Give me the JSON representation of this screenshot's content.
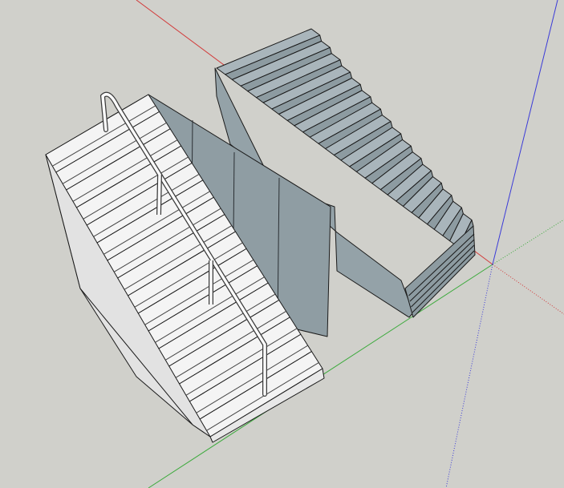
{
  "viewport": {
    "background": "#d0d0cb",
    "axis_colors": {
      "red": "#d23a3a",
      "green": "#3caa3c",
      "blue": "#3a3ad8"
    }
  },
  "models": {
    "white_stair": {
      "tread_color": "#f4f4f4",
      "side_color": "#e2e2e2",
      "edge_color": "#1a1a1a",
      "step_count": 16,
      "handrail_post_count": 4
    },
    "gray_stair": {
      "tread_color": "#a9b5bb",
      "riser_color": "#8d9ba1",
      "side_color": "#94a2a8",
      "edge_color": "#1a1a1a",
      "step_count": 16
    },
    "partition_wall": {
      "color": "#8f9da3",
      "panel_count": 4
    }
  }
}
